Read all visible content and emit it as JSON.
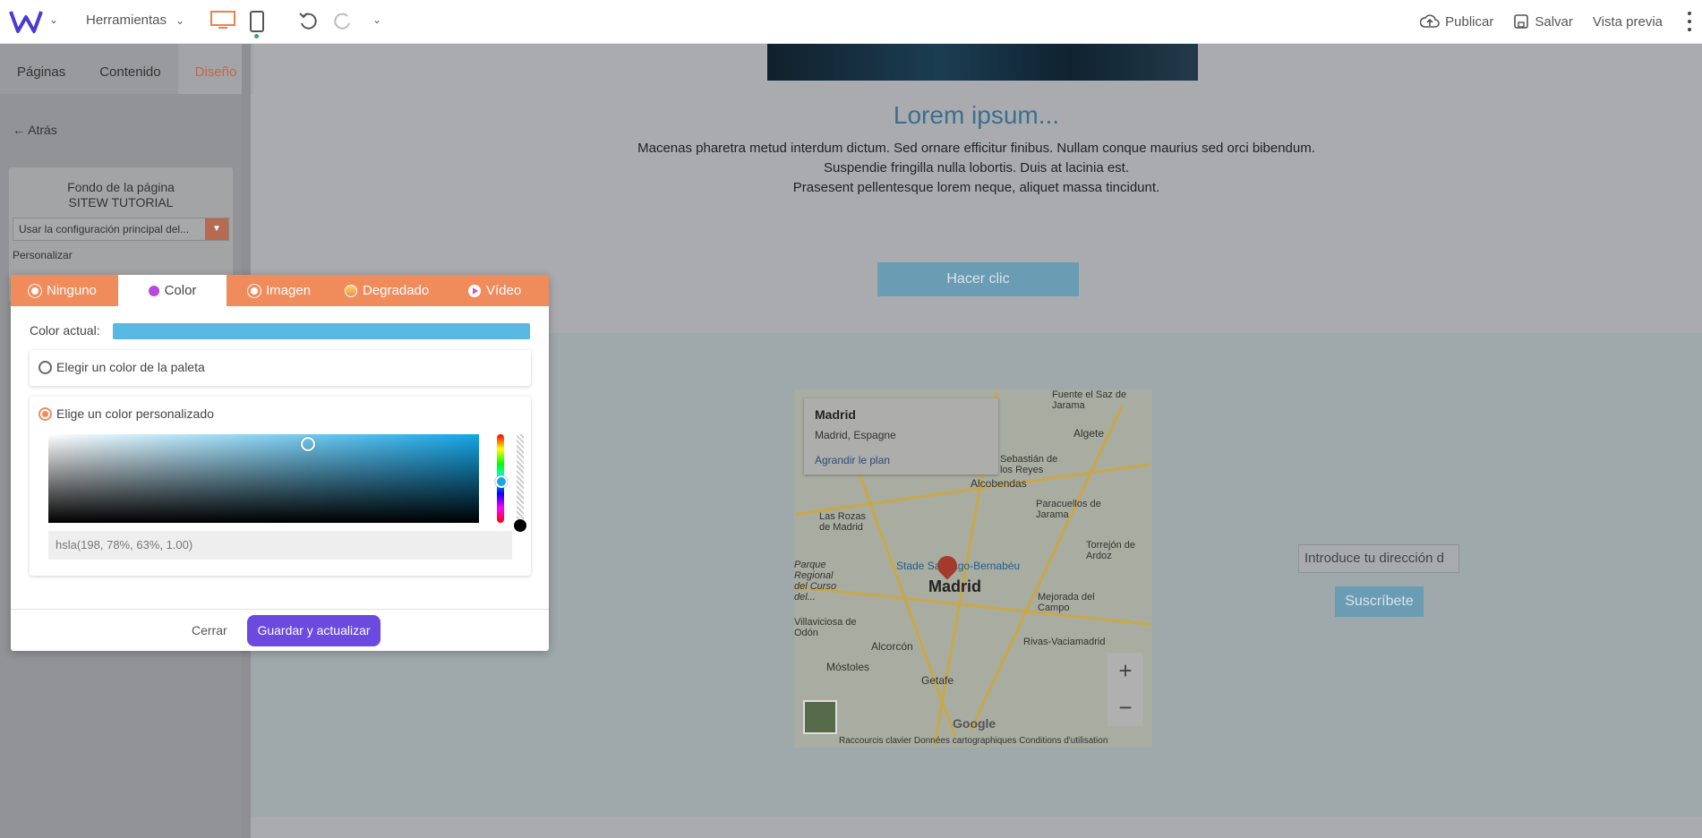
{
  "topbar": {
    "tools_label": "Herramientas",
    "publish": "Publicar",
    "save": "Salvar",
    "preview": "Vista previa"
  },
  "sidebar": {
    "tabs": [
      "Páginas",
      "Contenido",
      "Diseño"
    ],
    "back": "Atrás",
    "panel": {
      "title_line1": "Fondo de la página",
      "title_line2": "SITEW TUTORIAL",
      "select_value": "Usar la configuración principal del...",
      "label": "Personalizar"
    }
  },
  "page": {
    "title": "Lorem ipsum...",
    "body_lines": [
      "Macenas pharetra metud interdum dictum. Sed ornare efficitur finibus. Nullam conque maurius sed orci bibendum.",
      "Suspendie fringilla nulla lobortis. Duis at lacinia est.",
      "Prasesent pellentesque lorem neque, aliquet massa tincidunt."
    ],
    "cta": "Hacer clic",
    "email_placeholder": "Introduce tu dirección d",
    "subscribe": "Suscríbete"
  },
  "map": {
    "card_title": "Madrid",
    "card_subtitle": "Madrid, Espagne",
    "card_link": "Agrandir le plan",
    "labels": {
      "fuente": "Fuente el Saz de Jarama",
      "algete": "Algete",
      "sebastian": "Sebastián de los Reyes",
      "alcobendas": "Alcobendas",
      "paracuellos": "Paracuellos de Jarama",
      "rozas": "Las Rozas de Madrid",
      "torrejon": "Torrejón de Ardoz",
      "bernabeu": "Stade Santiago-Bernabéu",
      "mejorada": "Mejorada del Campo",
      "villaviciosa": "Villaviciosa de Odón",
      "alcorcon": "Alcorcón",
      "rivas": "Rivas-Vaciamadrid",
      "mostoles": "Móstoles",
      "getafe": "Getafe",
      "parque": "Parque Regional del Curso del..."
    },
    "city": "Madrid",
    "google": "Google",
    "footer": "Raccourcis clavier   Données cartographiques   Conditions d'utilisation"
  },
  "modal": {
    "tabs": [
      "Ninguno",
      "Color",
      "Imagen",
      "Degradado",
      "Vídeo"
    ],
    "current_label": "Color actual:",
    "current_color": "#59b8e2",
    "option_palette": "Elegir un color de la paleta",
    "option_custom": "Elige un color personalizado",
    "value": "hsla(198, 78%, 63%, 1.00)",
    "close": "Cerrar",
    "save": "Guardar y actualizar"
  },
  "colors": {
    "accent_orange": "#f08b5c",
    "save_purple": "#6c4ae0",
    "picked_blue": "#59b8e2"
  }
}
